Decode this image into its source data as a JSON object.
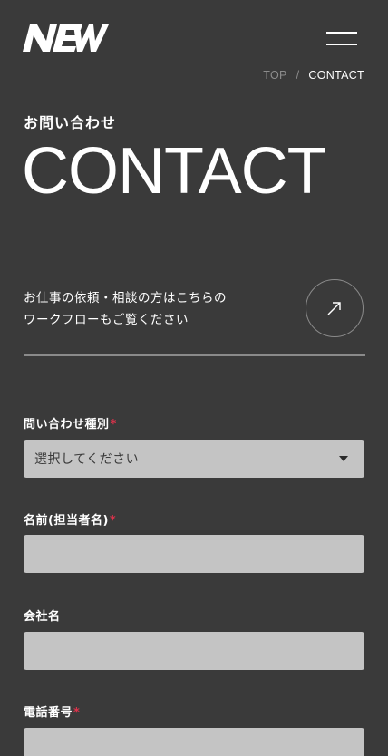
{
  "header": {
    "logo_text": "NEW",
    "logo_icon": "brand-logo",
    "menu_icon": "hamburger-menu-icon"
  },
  "breadcrumb": {
    "items": [
      "TOP",
      "CONTACT"
    ],
    "separator": "/"
  },
  "page": {
    "subtitle": "お問い合わせ",
    "title": "CONTACT"
  },
  "workflow": {
    "line1": "お仕事の依頼・相談の方はこちらの",
    "line2": "ワークフローもご覧ください",
    "link_icon": "arrow-up-right-icon"
  },
  "form": {
    "required_mark": "*",
    "fields": [
      {
        "label": "問い合わせ種別",
        "required": true,
        "type": "select",
        "value": "選択してください"
      },
      {
        "label": "名前(担当者名)",
        "required": true,
        "type": "text",
        "value": ""
      },
      {
        "label": "会社名",
        "required": false,
        "type": "text",
        "value": ""
      },
      {
        "label": "電話番号",
        "required": true,
        "type": "text",
        "value": ""
      }
    ]
  },
  "colors": {
    "background": "#3a3a3a",
    "field_background": "#c4c4c4",
    "required": "#e0324b",
    "muted": "#8c8c8c",
    "text": "#ffffff"
  }
}
